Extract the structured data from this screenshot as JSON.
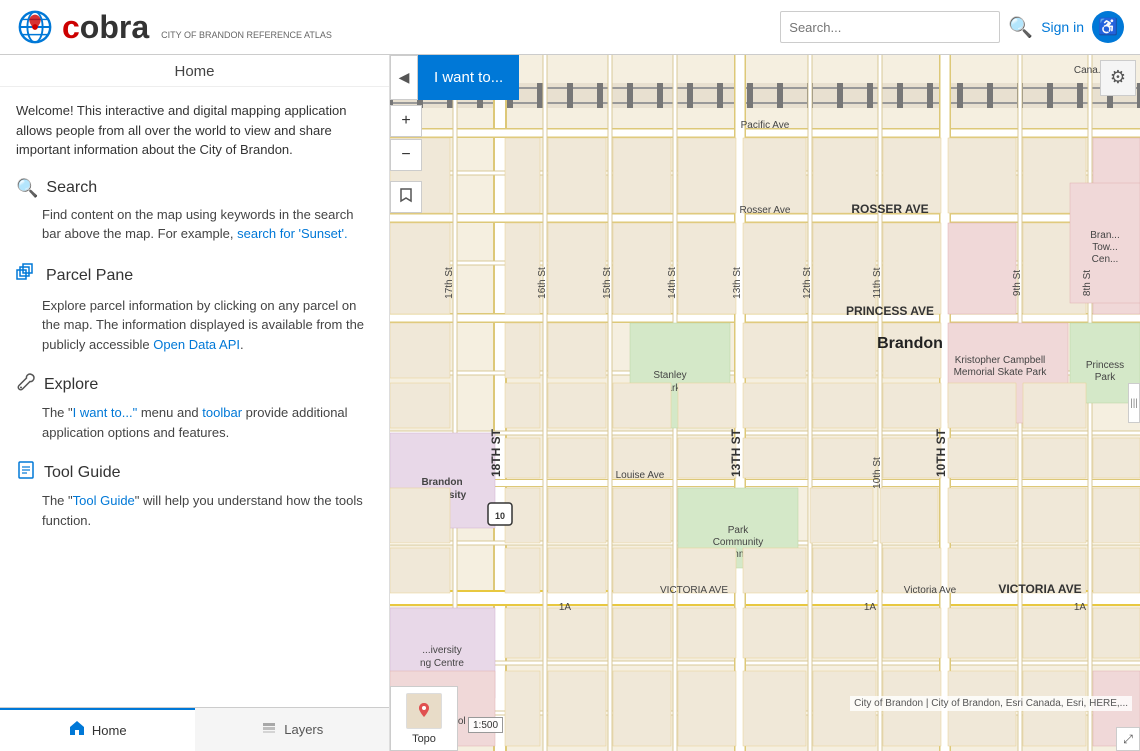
{
  "header": {
    "logo_text_c": "c",
    "logo_text_rest": "obra",
    "tagline": "CITY OF BRANDON REFERENCE ATLAS",
    "search_placeholder": "Search...",
    "search_btn_icon": "🔍",
    "signin_label": "Sign in",
    "accessibility_icon": "♿"
  },
  "sidebar": {
    "title": "Home",
    "welcome": "Welcome! This interactive and digital mapping application allows people from all over the world to view and share important information about the City of Brandon.",
    "sections": [
      {
        "id": "search",
        "icon": "🔍",
        "title": "Search",
        "body_prefix": "Find content on the map using keywords in the search bar above the map. For example, ",
        "link_text": "search for 'Sunset'.",
        "link_href": "#",
        "body_suffix": ""
      },
      {
        "id": "parcel-pane",
        "icon": "⊞",
        "title": "Parcel Pane",
        "body_prefix": "Explore parcel information by clicking on any parcel on the map. The information  displayed is available from the publicly accessible ",
        "link_text": "Open Data API",
        "link_href": "#",
        "body_suffix": "."
      },
      {
        "id": "explore",
        "icon": "🔧",
        "title": "Explore",
        "body_prefix": "The \"",
        "link_text": "I want to...\"",
        "link_href": "#",
        "body_middle": " menu and ",
        "link2_text": "toolbar",
        "link2_href": "#",
        "body_suffix": " provide additional application options and features."
      },
      {
        "id": "tool-guide",
        "icon": "📋",
        "title": "Tool Guide",
        "body_prefix": "The \"",
        "link_text": "Tool Guide",
        "link_href": "#",
        "body_suffix": "\" will help you understand how the tools function."
      }
    ],
    "footer_tabs": [
      {
        "id": "home",
        "icon": "🏠",
        "label": "Home",
        "active": true
      },
      {
        "id": "layers",
        "icon": "◫",
        "label": "Layers",
        "active": false
      }
    ]
  },
  "map": {
    "i_want_to_label": "I want to...",
    "collapse_icon": "◀",
    "settings_icon": "⚙",
    "zoom_in": "+",
    "zoom_out": "−",
    "bookmark_icon": "📖",
    "attribution": "City of Brandon | City of Brandon, Esri Canada, Esri, HERE,...",
    "topo_label": "Topo",
    "scale_label": "1:500",
    "expand_icon": "⤢",
    "streets": [
      "Pacific Ave",
      "Rosser Ave",
      "ROSSER AVE",
      "Princess Ave",
      "PRINCESS AVE",
      "VICTORIA AVE",
      "Louise Ave",
      "Victoria Ave",
      "17th St",
      "18TH ST",
      "16th St",
      "15th St",
      "14th St",
      "13TH ST",
      "13th St",
      "12th St",
      "11th St",
      "10th St",
      "10TH ST",
      "9th St",
      "8th St",
      "1A"
    ],
    "pois": [
      "Brandon",
      "Stanley Park",
      "Kristopher Campbell Memorial Skate Park",
      "Princess Park",
      "Park Community Common",
      "Brandon University",
      "Earl ...d School",
      "Bran... Tow... Cen...",
      "Canadian..."
    ]
  }
}
